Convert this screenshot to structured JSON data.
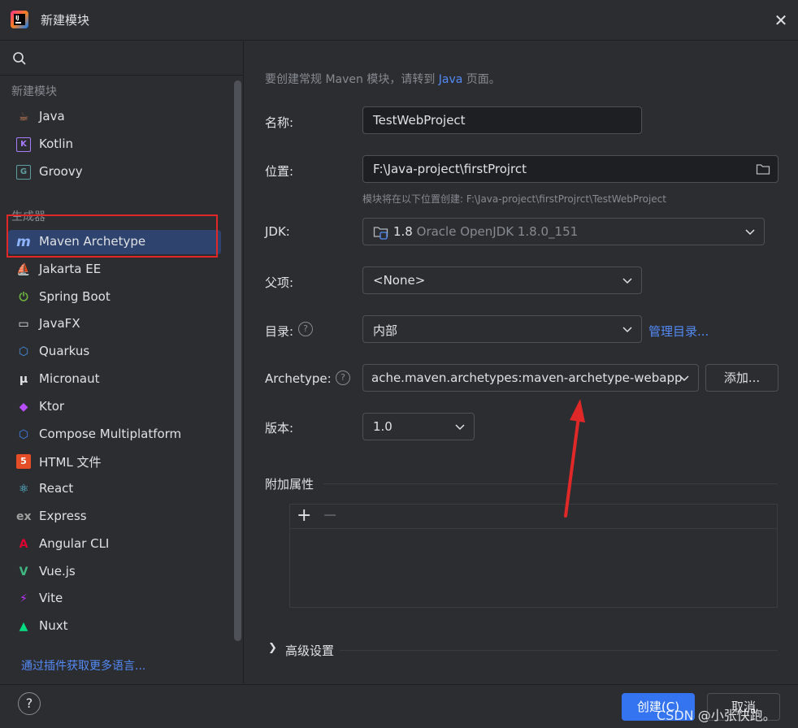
{
  "window": {
    "title": "新建模块",
    "close": "✕"
  },
  "sidebar": {
    "section_new": "新建模块",
    "new_items": [
      {
        "label": "Java",
        "icon": "cup-icon",
        "color": "#c77d55"
      },
      {
        "label": "Kotlin",
        "icon": "kotlin-icon",
        "color": "#a97bff"
      },
      {
        "label": "Groovy",
        "icon": "groovy-icon",
        "color": "#5f9ea0"
      }
    ],
    "section_gen": "生成器",
    "gen_items": [
      {
        "label": "Maven Archetype",
        "icon": "maven-icon",
        "color": "#8fb4ff",
        "selected": true
      },
      {
        "label": "Jakarta EE",
        "icon": "jakarta-icon",
        "color": "#f0a732"
      },
      {
        "label": "Spring Boot",
        "icon": "spring-icon",
        "color": "#6db33f"
      },
      {
        "label": "JavaFX",
        "icon": "javafx-icon",
        "color": "#dfe1e5"
      },
      {
        "label": "Quarkus",
        "icon": "quarkus-icon",
        "color": "#4695eb"
      },
      {
        "label": "Micronaut",
        "icon": "micronaut-icon",
        "color": "#dfe1e5"
      },
      {
        "label": "Ktor",
        "icon": "ktor-icon",
        "color": "#b74fff"
      },
      {
        "label": "Compose Multiplatform",
        "icon": "compose-icon",
        "color": "#4285f4"
      },
      {
        "label": "HTML 文件",
        "icon": "html5-icon",
        "color": "#e44d26"
      },
      {
        "label": "React",
        "icon": "react-icon",
        "color": "#61dafb"
      },
      {
        "label": "Express",
        "icon": "express-icon",
        "color": "#a0a0a0"
      },
      {
        "label": "Angular CLI",
        "icon": "angular-icon",
        "color": "#dd0031"
      },
      {
        "label": "Vue.js",
        "icon": "vue-icon",
        "color": "#41b883"
      },
      {
        "label": "Vite",
        "icon": "vite-icon",
        "color": "#bd34fe"
      },
      {
        "label": "Nuxt",
        "icon": "nuxt-icon",
        "color": "#00dc82"
      }
    ],
    "plugin_link": "通过插件获取更多语言..."
  },
  "form": {
    "info_prefix": "要创建常规 Maven 模块，请转到 ",
    "info_link": "Java",
    "info_suffix": " 页面。",
    "name_label": "名称:",
    "name_value": "TestWebProject",
    "location_label": "位置:",
    "location_value": "F:\\Java-project\\firstProjrct",
    "location_hint": "模块将在以下位置创建: F:\\Java-project\\firstProjrct\\TestWebProject",
    "jdk_label": "JDK:",
    "jdk_version": "1.8",
    "jdk_detail": "Oracle OpenJDK 1.8.0_151",
    "parent_label": "父项:",
    "parent_value": "<None>",
    "catalog_label": "目录:",
    "catalog_value": "内部",
    "catalog_link": "管理目录...",
    "archetype_label": "Archetype:",
    "archetype_value": "ache.maven.archetypes:maven-archetype-webapp",
    "archetype_add": "添加...",
    "version_label": "版本:",
    "version_value": "1.0",
    "props_title": "附加属性",
    "add_symbol": "+",
    "remove_symbol": "−",
    "advanced_label": "高级设置",
    "help_symbol": "?"
  },
  "footer": {
    "help": "?",
    "create": "创建(C)",
    "cancel": "取消",
    "watermark": "CSDN @小张快跑。"
  },
  "colors": {
    "accent": "#3574f0",
    "link": "#548af7",
    "selection": "#2e436e",
    "annotation": "#e02828"
  }
}
